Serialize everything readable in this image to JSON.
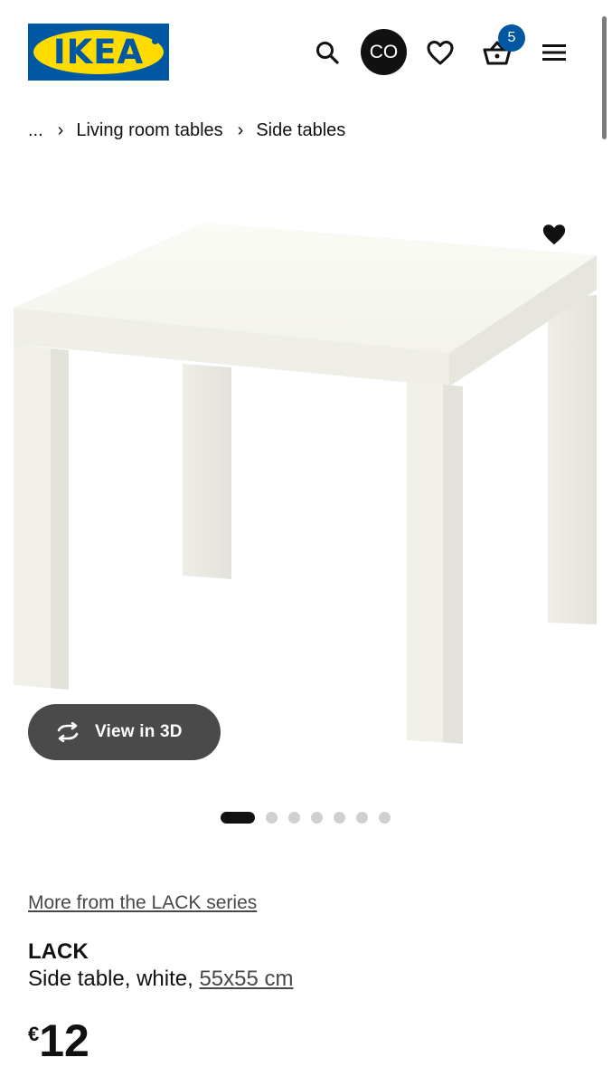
{
  "header": {
    "logo_text": "IKEA",
    "avatar_initials": "CO",
    "cart_count": "5",
    "colors": {
      "brand_blue": "#0058a3",
      "brand_yellow": "#ffdb00"
    },
    "icons": [
      "search-icon",
      "heart-outline-icon",
      "basket-icon",
      "hamburger-menu-icon"
    ]
  },
  "breadcrumb": {
    "ellipsis": "...",
    "items": [
      "Living room tables",
      "Side tables"
    ],
    "separator": "›"
  },
  "gallery": {
    "view3d_label": "View in 3D",
    "page_count": 7,
    "active_page": 1
  },
  "product": {
    "series_link": "More from the LACK series",
    "name": "LACK",
    "description": "Side table, white, ",
    "size": "55x55 cm",
    "price_currency": "€",
    "price_amount": "12"
  }
}
